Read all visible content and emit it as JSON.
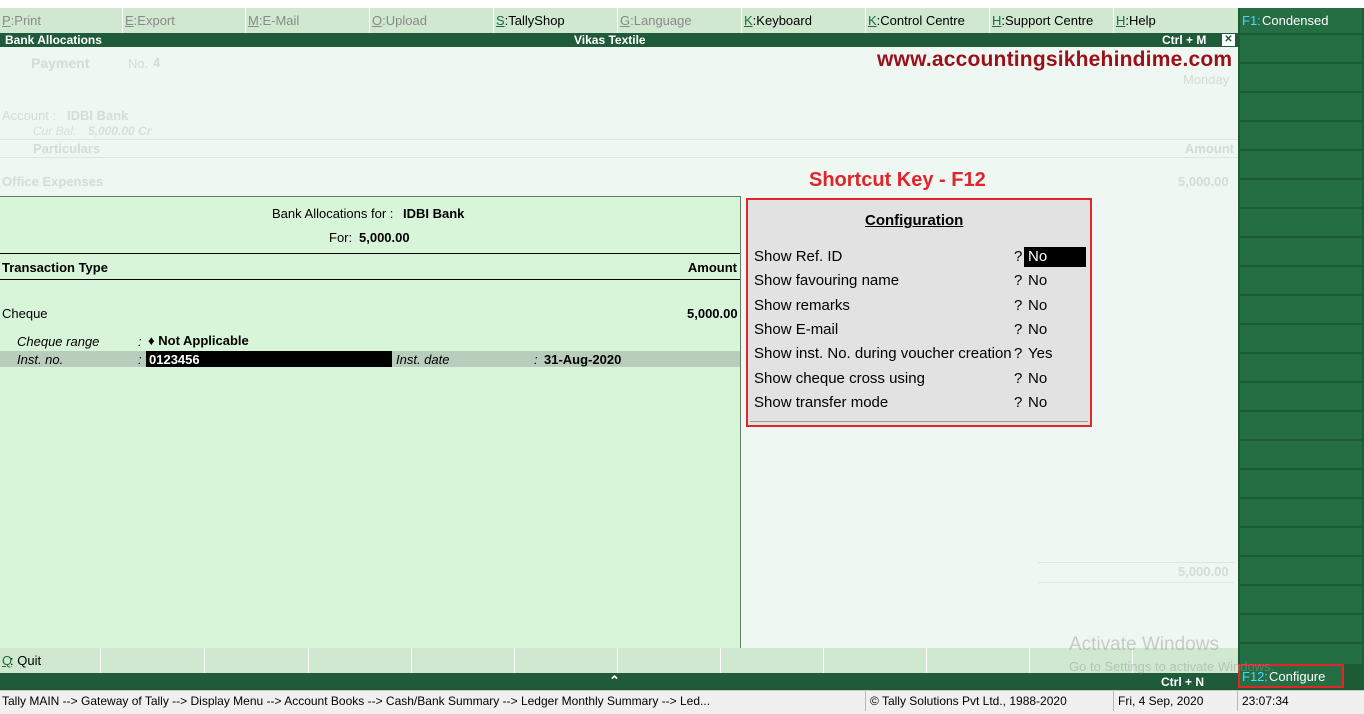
{
  "menu": {
    "items": [
      {
        "key": "P",
        "label": "Print",
        "disabled": true
      },
      {
        "key": "E",
        "label": "Export",
        "disabled": true
      },
      {
        "key": "M",
        "label": "E-Mail",
        "disabled": true
      },
      {
        "key": "O",
        "label": "Upload",
        "disabled": true
      },
      {
        "key": "S",
        "label": "TallyShop",
        "disabled": false
      },
      {
        "key": "G",
        "label": "Language",
        "disabled": true
      },
      {
        "key": "K",
        "label": "Keyboard",
        "disabled": false
      },
      {
        "key": "K",
        "label": "Control Centre",
        "disabled": false
      },
      {
        "key": "H",
        "label": "Support Centre",
        "disabled": false
      },
      {
        "key": "H",
        "label": "Help",
        "disabled": false
      }
    ]
  },
  "titlebar": {
    "left": "Bank Allocations",
    "center": "Vikas Textile",
    "shortcut": "Ctrl + M",
    "close_glyph": "✕"
  },
  "watermark": {
    "site": "www.accountingsikhehindime.com",
    "note": "Shortcut Key - F12"
  },
  "voucher": {
    "type": "Payment",
    "no_label": "No.",
    "no_value": "4",
    "day": "Monday",
    "account_label": "Account :",
    "account_value": "IDBI Bank",
    "cur_bal_label": "Cur Bal:",
    "cur_bal_value": "5,000.00 Cr",
    "particulars_header": "Particulars",
    "amount_header": "Amount",
    "ledger": "Office Expenses",
    "ledger_amount": "5,000.00",
    "total_amount": "5,000.00"
  },
  "allocation": {
    "title_label": "Bank Allocations for :",
    "title_value": "IDBI Bank",
    "for_label": "For:",
    "for_value": "5,000.00",
    "col_type": "Transaction Type",
    "col_amount": "Amount",
    "type_value": "Cheque",
    "amount_value": "5,000.00",
    "cheque_range_label": "Cheque range",
    "cheque_range_value": "♦ Not Applicable",
    "inst_no_label": "Inst. no.",
    "inst_no_value": "0123456",
    "inst_date_label": "Inst. date",
    "inst_date_value": "31-Aug-2020",
    "colon": ":"
  },
  "config": {
    "title": "Configuration",
    "rows": [
      {
        "label": "Show Ref. ID",
        "value": "No",
        "selected": true
      },
      {
        "label": "Show favouring name",
        "value": "No",
        "selected": false
      },
      {
        "label": "Show remarks",
        "value": "No",
        "selected": false
      },
      {
        "label": "Show E-mail",
        "value": "No",
        "selected": false
      },
      {
        "label": "Show inst. No. during voucher creation",
        "value": "Yes",
        "selected": false
      },
      {
        "label": "Show cheque cross using",
        "value": "No",
        "selected": false
      },
      {
        "label": "Show transfer mode",
        "value": "No",
        "selected": false
      }
    ],
    "q": "?"
  },
  "rightpanel": {
    "f1_key": "F1:",
    "f1_label": "Condensed",
    "f12_key": "F12:",
    "f12_label": "Configure"
  },
  "bottom": {
    "quit_key": "Q",
    "quit_label": ": Quit",
    "ctrl_n": "Ctrl + N",
    "up_glyph": "⌃"
  },
  "activate": {
    "line1": "Activate Windows",
    "line2": "Go to Settings to activate Windows."
  },
  "status": {
    "path": "Tally MAIN --> Gateway of Tally --> Display Menu --> Account Books --> Cash/Bank Summary --> Ledger Monthly Summary --> Led...",
    "copyright": "© Tally Solutions Pvt Ltd., 1988-2020",
    "date": "Fri, 4 Sep, 2020",
    "time": "23:07:34"
  },
  "colors": {
    "accent_red": "#e0252b",
    "title_green": "#1f5a3a",
    "panel_green": "#d9f5d9"
  }
}
